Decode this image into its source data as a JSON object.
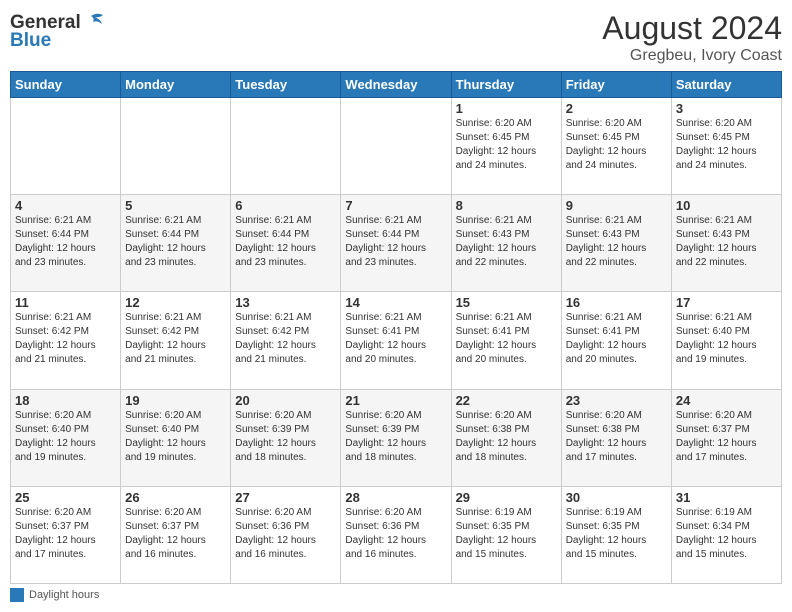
{
  "header": {
    "logo_line1": "General",
    "logo_line2": "Blue",
    "main_title": "August 2024",
    "subtitle": "Gregbeu, Ivory Coast"
  },
  "days_of_week": [
    "Sunday",
    "Monday",
    "Tuesday",
    "Wednesday",
    "Thursday",
    "Friday",
    "Saturday"
  ],
  "weeks": [
    [
      {
        "day": "",
        "info": ""
      },
      {
        "day": "",
        "info": ""
      },
      {
        "day": "",
        "info": ""
      },
      {
        "day": "",
        "info": ""
      },
      {
        "day": "1",
        "info": "Sunrise: 6:20 AM\nSunset: 6:45 PM\nDaylight: 12 hours\nand 24 minutes."
      },
      {
        "day": "2",
        "info": "Sunrise: 6:20 AM\nSunset: 6:45 PM\nDaylight: 12 hours\nand 24 minutes."
      },
      {
        "day": "3",
        "info": "Sunrise: 6:20 AM\nSunset: 6:45 PM\nDaylight: 12 hours\nand 24 minutes."
      }
    ],
    [
      {
        "day": "4",
        "info": "Sunrise: 6:21 AM\nSunset: 6:44 PM\nDaylight: 12 hours\nand 23 minutes."
      },
      {
        "day": "5",
        "info": "Sunrise: 6:21 AM\nSunset: 6:44 PM\nDaylight: 12 hours\nand 23 minutes."
      },
      {
        "day": "6",
        "info": "Sunrise: 6:21 AM\nSunset: 6:44 PM\nDaylight: 12 hours\nand 23 minutes."
      },
      {
        "day": "7",
        "info": "Sunrise: 6:21 AM\nSunset: 6:44 PM\nDaylight: 12 hours\nand 23 minutes."
      },
      {
        "day": "8",
        "info": "Sunrise: 6:21 AM\nSunset: 6:43 PM\nDaylight: 12 hours\nand 22 minutes."
      },
      {
        "day": "9",
        "info": "Sunrise: 6:21 AM\nSunset: 6:43 PM\nDaylight: 12 hours\nand 22 minutes."
      },
      {
        "day": "10",
        "info": "Sunrise: 6:21 AM\nSunset: 6:43 PM\nDaylight: 12 hours\nand 22 minutes."
      }
    ],
    [
      {
        "day": "11",
        "info": "Sunrise: 6:21 AM\nSunset: 6:42 PM\nDaylight: 12 hours\nand 21 minutes."
      },
      {
        "day": "12",
        "info": "Sunrise: 6:21 AM\nSunset: 6:42 PM\nDaylight: 12 hours\nand 21 minutes."
      },
      {
        "day": "13",
        "info": "Sunrise: 6:21 AM\nSunset: 6:42 PM\nDaylight: 12 hours\nand 21 minutes."
      },
      {
        "day": "14",
        "info": "Sunrise: 6:21 AM\nSunset: 6:41 PM\nDaylight: 12 hours\nand 20 minutes."
      },
      {
        "day": "15",
        "info": "Sunrise: 6:21 AM\nSunset: 6:41 PM\nDaylight: 12 hours\nand 20 minutes."
      },
      {
        "day": "16",
        "info": "Sunrise: 6:21 AM\nSunset: 6:41 PM\nDaylight: 12 hours\nand 20 minutes."
      },
      {
        "day": "17",
        "info": "Sunrise: 6:21 AM\nSunset: 6:40 PM\nDaylight: 12 hours\nand 19 minutes."
      }
    ],
    [
      {
        "day": "18",
        "info": "Sunrise: 6:20 AM\nSunset: 6:40 PM\nDaylight: 12 hours\nand 19 minutes."
      },
      {
        "day": "19",
        "info": "Sunrise: 6:20 AM\nSunset: 6:40 PM\nDaylight: 12 hours\nand 19 minutes."
      },
      {
        "day": "20",
        "info": "Sunrise: 6:20 AM\nSunset: 6:39 PM\nDaylight: 12 hours\nand 18 minutes."
      },
      {
        "day": "21",
        "info": "Sunrise: 6:20 AM\nSunset: 6:39 PM\nDaylight: 12 hours\nand 18 minutes."
      },
      {
        "day": "22",
        "info": "Sunrise: 6:20 AM\nSunset: 6:38 PM\nDaylight: 12 hours\nand 18 minutes."
      },
      {
        "day": "23",
        "info": "Sunrise: 6:20 AM\nSunset: 6:38 PM\nDaylight: 12 hours\nand 17 minutes."
      },
      {
        "day": "24",
        "info": "Sunrise: 6:20 AM\nSunset: 6:37 PM\nDaylight: 12 hours\nand 17 minutes."
      }
    ],
    [
      {
        "day": "25",
        "info": "Sunrise: 6:20 AM\nSunset: 6:37 PM\nDaylight: 12 hours\nand 17 minutes."
      },
      {
        "day": "26",
        "info": "Sunrise: 6:20 AM\nSunset: 6:37 PM\nDaylight: 12 hours\nand 16 minutes."
      },
      {
        "day": "27",
        "info": "Sunrise: 6:20 AM\nSunset: 6:36 PM\nDaylight: 12 hours\nand 16 minutes."
      },
      {
        "day": "28",
        "info": "Sunrise: 6:20 AM\nSunset: 6:36 PM\nDaylight: 12 hours\nand 16 minutes."
      },
      {
        "day": "29",
        "info": "Sunrise: 6:19 AM\nSunset: 6:35 PM\nDaylight: 12 hours\nand 15 minutes."
      },
      {
        "day": "30",
        "info": "Sunrise: 6:19 AM\nSunset: 6:35 PM\nDaylight: 12 hours\nand 15 minutes."
      },
      {
        "day": "31",
        "info": "Sunrise: 6:19 AM\nSunset: 6:34 PM\nDaylight: 12 hours\nand 15 minutes."
      }
    ]
  ],
  "legend": {
    "label": "Daylight hours"
  }
}
